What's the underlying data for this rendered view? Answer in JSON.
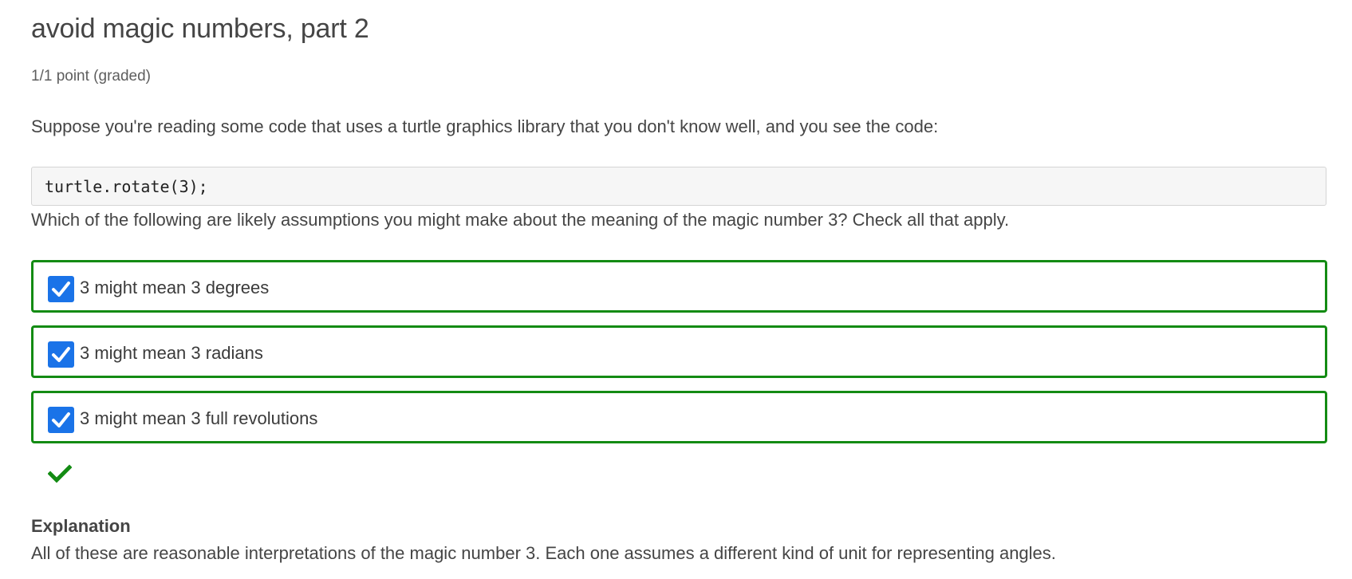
{
  "problem": {
    "title": "avoid magic numbers, part 2",
    "points": "1/1 point (graded)",
    "prompt": "Suppose you're reading some code that uses a turtle graphics library that you don't know well, and you see the code:",
    "code": "turtle.rotate(3);",
    "question": "Which of the following are likely assumptions you might make about the meaning of the magic number 3? Check all that apply.",
    "choices": [
      {
        "label": "3 might mean 3 degrees",
        "checked": true
      },
      {
        "label": "3 might mean 3 radians",
        "checked": true
      },
      {
        "label": "3 might mean 3 full revolutions",
        "checked": true
      }
    ],
    "status_icon": "checkmark-icon",
    "explanation": {
      "title": "Explanation",
      "text": "All of these are reasonable interpretations of the magic number 3. Each one assumes a different kind of unit for representing angles."
    }
  },
  "colors": {
    "correct_border": "#138b13",
    "checkbox_fill": "#1a73e8",
    "correct_icon": "#138b13"
  }
}
